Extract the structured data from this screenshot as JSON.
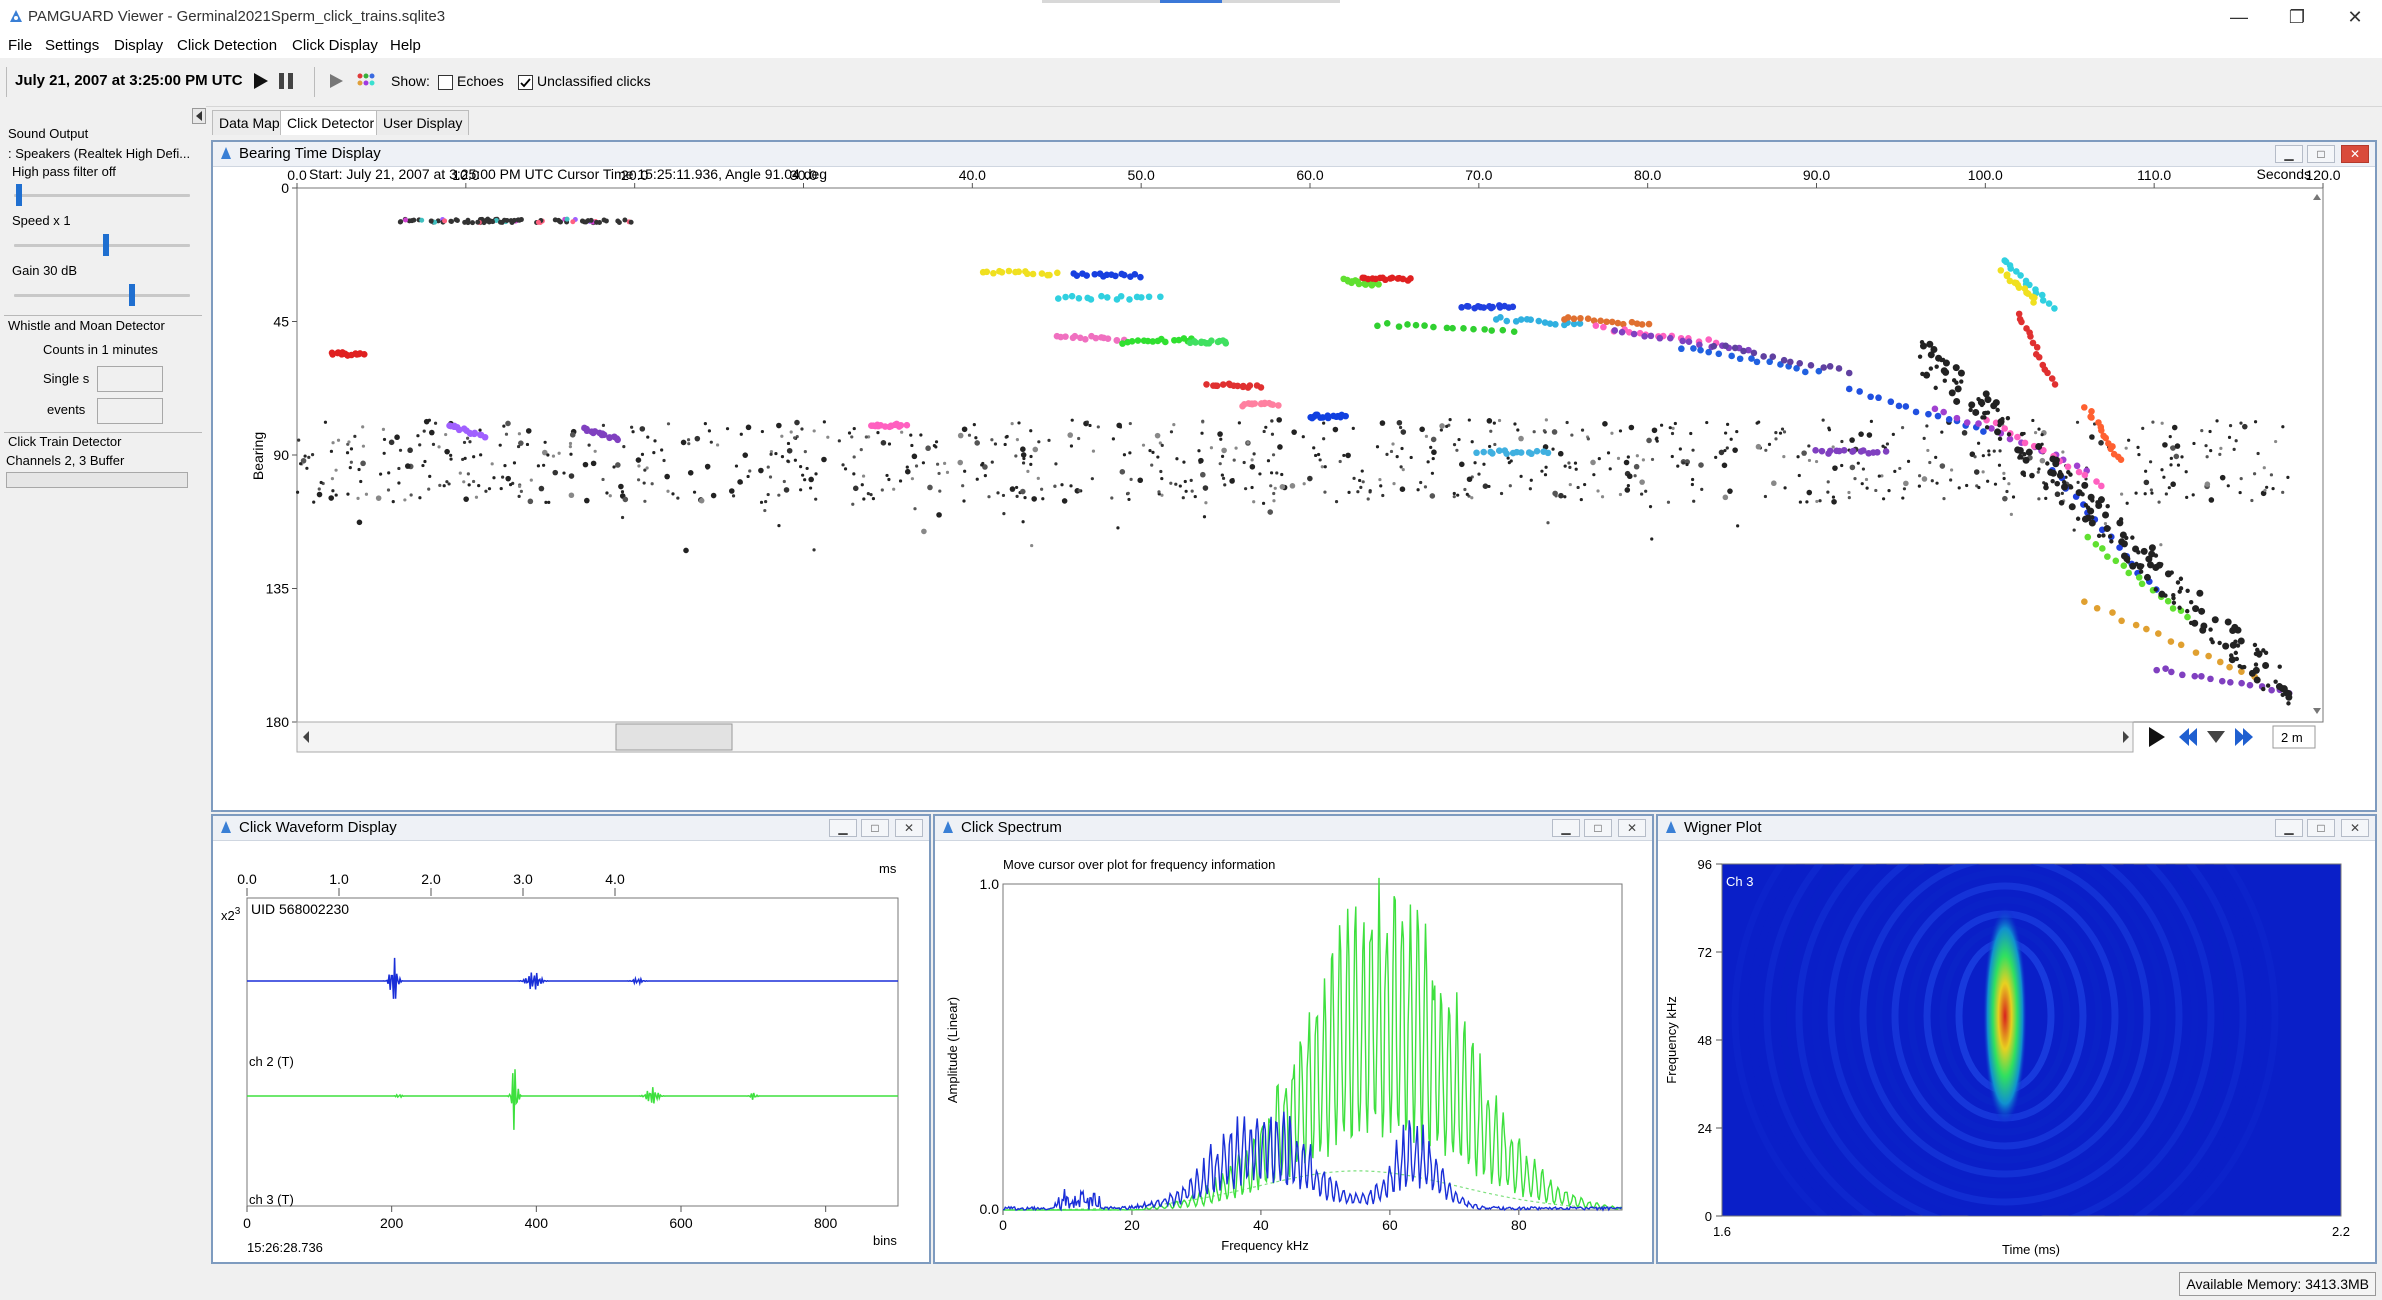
{
  "window": {
    "title": "PAMGUARD Viewer - Germinal2021Sperm_click_trains.sqlite3",
    "controls": {
      "minimize": "—",
      "restore": "❐",
      "close": "✕"
    }
  },
  "menu": [
    "File",
    "Settings",
    "Display",
    "Click Detection",
    "Click Display",
    "Help"
  ],
  "toolbar": {
    "datetime": "July 21, 2007 at 3:25:00 PM UTC",
    "show_label": "Show:",
    "echoes_label": "Echoes",
    "echoes_checked": false,
    "unclassified_label": "Unclassified clicks",
    "unclassified_checked": true
  },
  "left_panel": {
    "sound_output_title": "Sound Output",
    "sound_device": ": Speakers (Realtek High Defi...",
    "high_pass": "High pass filter off",
    "speed_label": "Speed  x 1",
    "gain_label": "Gain 30 dB",
    "whistle_title": "Whistle and Moan Detector",
    "counts_label": "Counts in 1 minutes",
    "single_label": "Single s",
    "events_label": "events",
    "click_train_title": "Click Train  Detector",
    "buffer_label": "Channels 2, 3 Buffer",
    "high_pass_level": 0.03,
    "speed_level": 0.52,
    "gain_level": 0.67
  },
  "tabs": [
    {
      "label": "Data Map",
      "active": false
    },
    {
      "label": "Click Detector",
      "active": true
    },
    {
      "label": "User Display",
      "active": false
    }
  ],
  "bearing_display": {
    "title": "Bearing Time Display",
    "info": "Start: July 21, 2007 at 3:25:00 PM UTC    Cursor Time 15:25:11.936, Angle 91.04 deg",
    "x_unit": "Seconds",
    "x_ticks": [
      "0.0",
      "10.0",
      "20.0",
      "30.0",
      "40.0",
      "50.0",
      "60.0",
      "70.0",
      "80.0",
      "90.0",
      "100.0",
      "110.0",
      "120.0"
    ],
    "y_ticks": [
      "0",
      "45",
      "90",
      "135",
      "180"
    ],
    "y_label": "Bearing",
    "span_value": "2 m"
  },
  "waveform": {
    "title": "Click Waveform Display",
    "top_unit": "ms",
    "top_ticks": [
      "0.0",
      "1.0",
      "2.0",
      "3.0",
      "4.0"
    ],
    "scale_label": "x2",
    "scale_exp": "3",
    "uid_label": "UID 568002230",
    "ch2_label": "ch 2 (T)",
    "ch3_label": "ch 3 (T)",
    "bottom_ticks": [
      "0",
      "200",
      "400",
      "600",
      "800"
    ],
    "bottom_unit": "bins",
    "time_label": "15:26:28.736"
  },
  "spectrum": {
    "title": "Click Spectrum",
    "hint": "Move cursor over plot for frequency information",
    "y_label": "Amplitude (Linear)",
    "y_ticks": [
      "1.0",
      "0.0"
    ],
    "x_ticks": [
      "0",
      "20",
      "40",
      "60",
      "80"
    ],
    "x_label": "Frequency kHz"
  },
  "wigner": {
    "title": "Wigner Plot",
    "channel_label": "Ch 3",
    "y_label": "Frequency kHz",
    "y_ticks": [
      "96",
      "72",
      "48",
      "24",
      "0"
    ],
    "x_ticks": [
      "1.6",
      "2.2"
    ],
    "x_label": "Time (ms)"
  },
  "status": {
    "memory": "Available Memory: 3413.3MB"
  },
  "colors": {
    "frame_border": "#7e9bbf",
    "wave_ch2": "#1a2fd8",
    "wave_ch3": "#3ee03e",
    "wigner_bg": "#0a1fc8"
  }
}
